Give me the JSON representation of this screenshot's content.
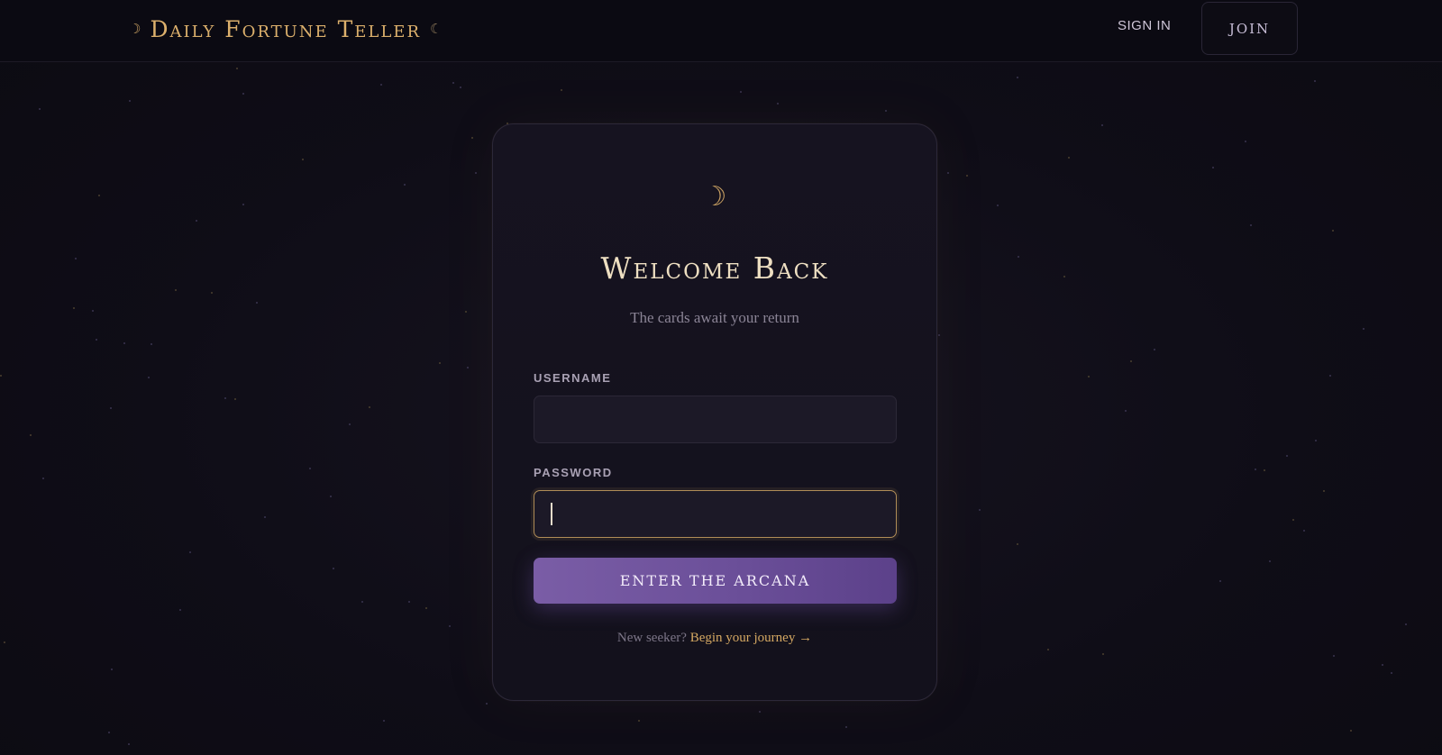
{
  "header": {
    "brand_moon_left": "☽",
    "brand_title": "Daily Fortune Teller",
    "brand_moon_right": "☾",
    "signin_label": "SIGN IN",
    "join_label": "JOIN"
  },
  "card": {
    "moon": "☽",
    "title": "Welcome Back",
    "subtitle": "The cards await your return",
    "username_label": "USERNAME",
    "username_value": "",
    "password_label": "PASSWORD",
    "password_value": "",
    "submit_label": "ENTER THE ARCANA",
    "footer_prefix": "New seeker?",
    "footer_link": "Begin your journey →"
  },
  "colors": {
    "background": "#0e0c16",
    "gold_accent": "#d7ad6a",
    "button_purple": "#6b4f99"
  }
}
